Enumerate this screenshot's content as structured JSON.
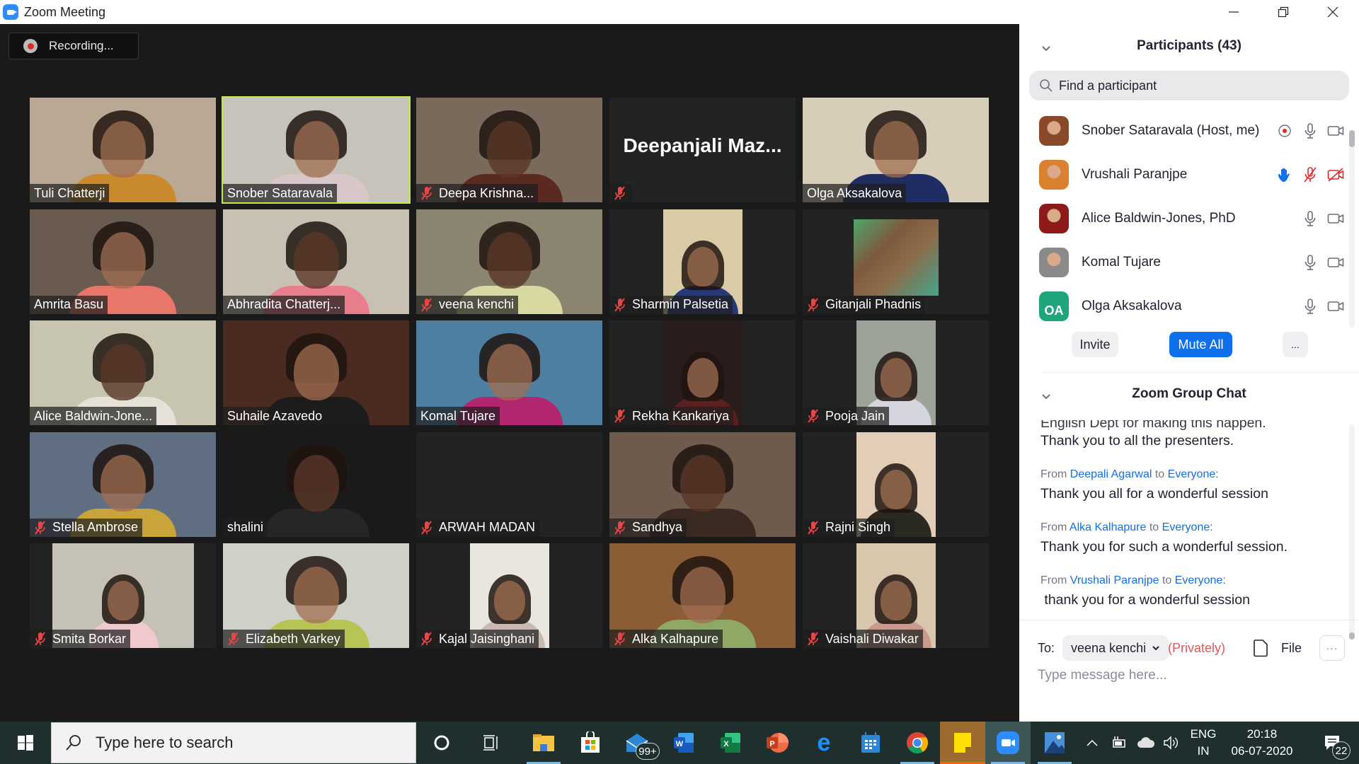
{
  "window": {
    "title": "Zoom Meeting",
    "controls": {
      "minimize": "—",
      "maximize": "❐",
      "close": "✕"
    }
  },
  "recording": {
    "label": "Recording..."
  },
  "video_tiles": [
    {
      "name": "Tuli Chatterji",
      "muted": false,
      "video": "full",
      "bg": "#b9a893",
      "tone": "light",
      "body": "#c98a2e",
      "active": false
    },
    {
      "name": "Snober Sataravala",
      "muted": false,
      "video": "full",
      "bg": "#c6c3bb",
      "tone": "light",
      "body": "#d7c7c9",
      "active": true
    },
    {
      "name": "Deepa Krishna...",
      "muted": true,
      "video": "full",
      "bg": "#7a6a5c",
      "tone": "dark",
      "body": "#5a2a20",
      "active": false
    },
    {
      "name": "",
      "display_name": "Deepanjali  Maz...",
      "muted": true,
      "video": "none",
      "active": false
    },
    {
      "name": "Olga Aksakalova",
      "muted": false,
      "video": "full",
      "bg": "#d7cdb8",
      "tone": "light",
      "body": "#1f2d63",
      "active": false
    },
    {
      "name": "Amrita Basu",
      "muted": false,
      "video": "full",
      "bg": "#6a5b50",
      "tone": "light",
      "body": "#e8776a",
      "active": false
    },
    {
      "name": "Abhradita Chatterj...",
      "muted": false,
      "video": "full",
      "bg": "#c8c0b3",
      "tone": "dark",
      "body": "#e97e8d",
      "active": false
    },
    {
      "name": "veena kenchi",
      "muted": true,
      "video": "full",
      "bg": "#8a8470",
      "tone": "dark",
      "body": "#d8d9a2",
      "active": false
    },
    {
      "name": "Sharmin Palsetia",
      "muted": true,
      "video": "portrait",
      "bg": "#d9cba6",
      "tone": "light",
      "body": "#243a78",
      "active": false
    },
    {
      "name": "Gitanjali Phadnis",
      "muted": true,
      "video": "portrait-game",
      "bg": "#6d8f6a",
      "tone": "none",
      "body": "#7a5a3a",
      "active": false
    },
    {
      "name": "Alice Baldwin-Jone...",
      "muted": false,
      "video": "full",
      "bg": "#c7c5b0",
      "tone": "dark",
      "body": "#e6e1d8",
      "active": false
    },
    {
      "name": "Suhaile Azavedo",
      "muted": false,
      "video": "full",
      "bg": "#4a2b22",
      "tone": "light",
      "body": "#1c1c1c",
      "active": false
    },
    {
      "name": "Komal Tujare",
      "muted": false,
      "video": "full",
      "bg": "#4f7fa0",
      "tone": "light",
      "body": "#b0276f",
      "active": false
    },
    {
      "name": "Rekha Kankariya",
      "muted": true,
      "video": "portrait",
      "bg": "#2a1c1c",
      "tone": "light",
      "body": "#5a2020",
      "active": false
    },
    {
      "name": "Pooja Jain",
      "muted": true,
      "video": "portrait",
      "bg": "#9ea39a",
      "tone": "light",
      "body": "#d5d5de",
      "active": false
    },
    {
      "name": "Stella Ambrose",
      "muted": true,
      "video": "full",
      "bg": "#5f6e80",
      "tone": "light",
      "body": "#c9a43a",
      "active": false
    },
    {
      "name": "shalini",
      "muted": false,
      "video": "full",
      "bg": "#1a1a1a",
      "tone": "dark",
      "body": "#262626",
      "active": false
    },
    {
      "name": "ARWAH MADAN",
      "muted": true,
      "video": "none",
      "active": false
    },
    {
      "name": "Sandhya",
      "muted": true,
      "video": "full",
      "bg": "#6f5a4e",
      "tone": "dark",
      "body": "#3a2a22",
      "active": false
    },
    {
      "name": "Rajni Singh",
      "muted": true,
      "video": "portrait",
      "bg": "#e2cdb6",
      "tone": "light",
      "body": "#2a2a22",
      "active": false
    },
    {
      "name": "Smita Borkar",
      "muted": true,
      "video": "portrait-wide",
      "bg": "#c6c1b6",
      "tone": "light",
      "body": "#f0c9cf",
      "active": false
    },
    {
      "name": "Elizabeth Varkey",
      "muted": true,
      "video": "full",
      "bg": "#cfd0c8",
      "tone": "light",
      "body": "#b7c455",
      "active": false
    },
    {
      "name": "Kajal Jaisinghani",
      "muted": true,
      "video": "portrait",
      "bg": "#e9e6df",
      "tone": "light",
      "body": "#cab9b0",
      "active": false
    },
    {
      "name": "Alka Kalhapure",
      "muted": true,
      "video": "full",
      "bg": "#8a5d36",
      "tone": "light",
      "body": "#8fa866",
      "active": false
    },
    {
      "name": "Vaishali Diwakar",
      "muted": true,
      "video": "portrait",
      "bg": "#d8c7ad",
      "tone": "light",
      "body": "#c99a8d",
      "active": false
    }
  ],
  "participants_panel": {
    "title": "Participants (43)",
    "search_placeholder": "Find a participant",
    "participants": [
      {
        "name": "Snober Sataravala (Host, me)",
        "avatar": "photo",
        "avatar_bg": "#8a4a2a",
        "recording": true,
        "hand_raised": false,
        "mic_muted": false,
        "video_off": false
      },
      {
        "name": "Vrushali Paranjpe",
        "avatar": "photo",
        "avatar_bg": "#d9812e",
        "recording": false,
        "hand_raised": true,
        "mic_muted": true,
        "video_off": true
      },
      {
        "name": "Alice Baldwin-Jones, PhD",
        "avatar": "photo",
        "avatar_bg": "#8c1a1a",
        "recording": false,
        "hand_raised": false,
        "mic_muted": false,
        "video_off": false
      },
      {
        "name": "Komal Tujare",
        "avatar": "photo",
        "avatar_bg": "#8a8a8a",
        "recording": false,
        "hand_raised": false,
        "mic_muted": false,
        "video_off": false
      },
      {
        "name": "Olga Aksakalova",
        "avatar": "initials",
        "initials": "OA",
        "avatar_bg": "#1ea57b",
        "recording": false,
        "hand_raised": false,
        "mic_muted": false,
        "video_off": false
      }
    ],
    "buttons": {
      "invite": "Invite",
      "mute_all": "Mute All",
      "more": "..."
    }
  },
  "chat_panel": {
    "title": "Zoom Group Chat",
    "cut_off_line": "English Dept for making this happen.",
    "first_visible_text": "Thank you to all the presenters.",
    "messages": [
      {
        "from_label": "From",
        "sender": "Deepali Agarwal",
        "to_label": "to",
        "recipient": "Everyone:",
        "text": "Thank you all for a wonderful session"
      },
      {
        "from_label": "From",
        "sender": "Alka Kalhapure",
        "to_label": "to",
        "recipient": "Everyone:",
        "text": "Thank you for such a wonderful session."
      },
      {
        "from_label": "From",
        "sender": "Vrushali Paranjpe",
        "to_label": "to",
        "recipient": "Everyone:",
        "text": " thank you for a wonderful session"
      }
    ],
    "to_label": "To:",
    "to_selected": "veena kenchi",
    "privately": "(Privately)",
    "file_label": "File",
    "more_label": "···",
    "input_placeholder": "Type message here..."
  },
  "taskbar": {
    "search_placeholder": "Type here to search",
    "apps": [
      {
        "name": "cortana",
        "running": false
      },
      {
        "name": "task-view",
        "running": false
      },
      {
        "name": "file-explorer",
        "running": true
      },
      {
        "name": "microsoft-store",
        "running": false
      },
      {
        "name": "mail",
        "running": false,
        "badge": "99+"
      },
      {
        "name": "word",
        "running": false
      },
      {
        "name": "excel",
        "running": false
      },
      {
        "name": "powerpoint",
        "running": false
      },
      {
        "name": "edge",
        "running": false
      },
      {
        "name": "calendar",
        "running": false
      },
      {
        "name": "chrome",
        "running": true
      },
      {
        "name": "sticky-notes",
        "running": true
      },
      {
        "name": "zoom",
        "running": true
      },
      {
        "name": "photos",
        "running": true
      }
    ],
    "language_top": "ENG",
    "language_bottom": "IN",
    "time": "20:18",
    "date": "06-07-2020",
    "notification_count": "22"
  }
}
